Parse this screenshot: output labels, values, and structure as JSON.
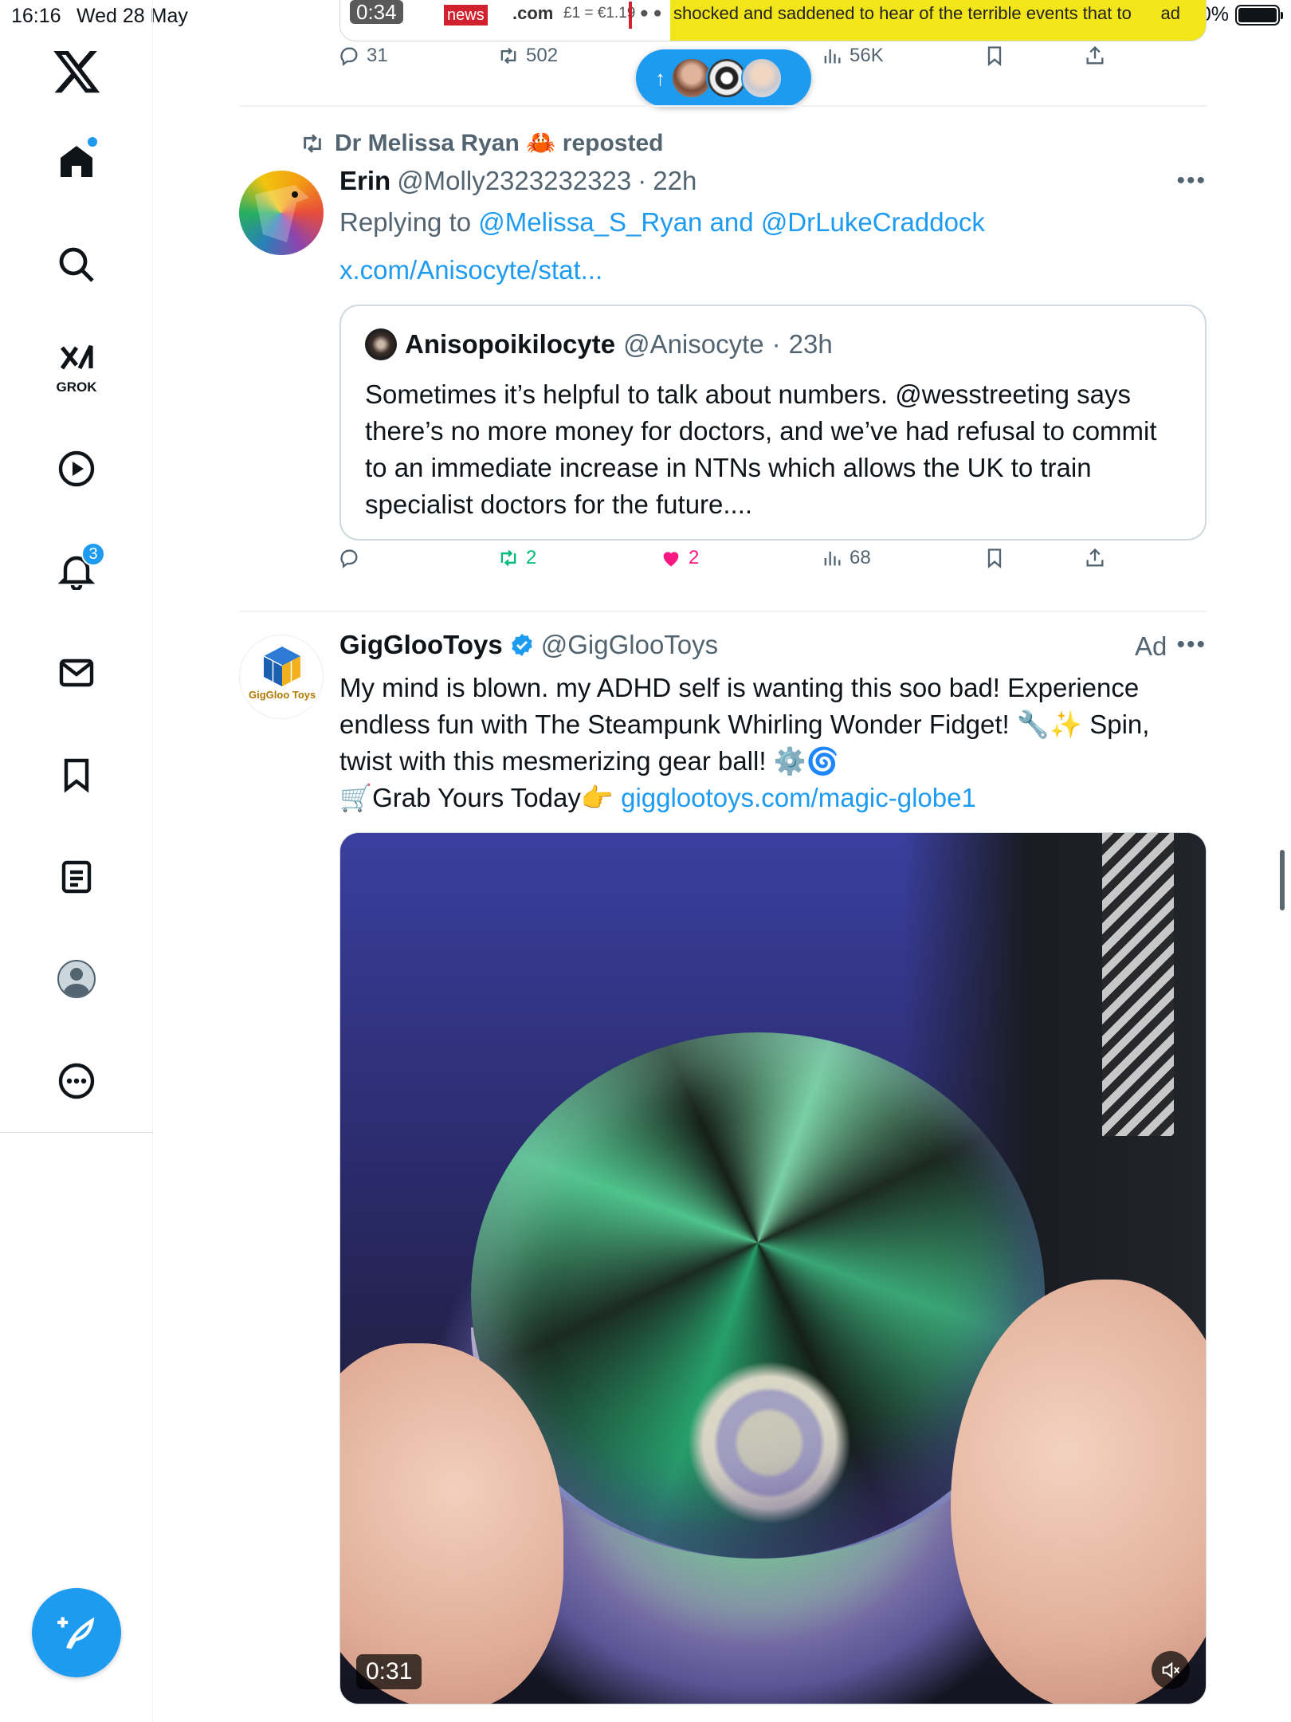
{
  "status_bar": {
    "time": "16:16",
    "date": "Wed 28 May",
    "battery": "100%"
  },
  "sidebar": {
    "grok_label": "GROK",
    "notifications_badge": "3",
    "items": [
      "home",
      "explore",
      "grok",
      "videos",
      "notifications",
      "messages",
      "bookmarks",
      "lists",
      "profile",
      "more"
    ]
  },
  "previous_post": {
    "media_timecode": "0:34",
    "media_news_logo": "news",
    "media_news_domain": ".com",
    "media_fx": "£1 = €1.19 ● ●",
    "media_ticker": "shocked and saddened to hear of the terrible events that to",
    "media_ticker_tail": "ad",
    "stats": {
      "replies": "31",
      "reposts": "502",
      "views": "56K"
    }
  },
  "new_posts_pill": {
    "arrow": "↑"
  },
  "tweet1": {
    "repost_by": "Dr Melissa Ryan 🦀 reposted",
    "name": "Erin",
    "handle": "@Molly2323232323",
    "separator": "·",
    "time": "22h",
    "replying_prefix": "Replying to",
    "replying_user1": "@Melissa_S_Ryan",
    "replying_and": "and",
    "replying_user2": "@DrLukeCraddock",
    "link": "x.com/Anisocyte/stat...",
    "quote": {
      "name": "Anisopoikilocyte",
      "handle": "@Anisocyte",
      "separator": "·",
      "time": "23h",
      "text": "Sometimes it’s helpful to talk about numbers. @wesstreeting says there’s no more money for doctors, and we’ve had refusal to commit to an immediate increase in NTNs which allows the UK to train specialist doctors for the future...."
    },
    "stats": {
      "replies": "",
      "reposts": "2",
      "likes": "2",
      "views": "68"
    }
  },
  "tweet2": {
    "name": "GigGlooToys",
    "handle": "@GigGlooToys",
    "ad_label": "Ad",
    "avatar_text": "GigGloo Toys",
    "text_line1": "My mind is blown. my ADHD self is wanting this soo bad! Experience endless fun with The Steampunk Whirling Wonder Fidget! 🔧✨ Spin, twist with this mesmerizing gear ball! ⚙️🌀",
    "text_line2": "🛒Grab Yours Today👉",
    "link": "gigglootoys.com/magic-globe1",
    "media_time": "0:31"
  },
  "colors": {
    "accent": "#1d9bf0",
    "muted": "#536471",
    "repost_green": "#00ba7c",
    "like_pink": "#f91880"
  }
}
